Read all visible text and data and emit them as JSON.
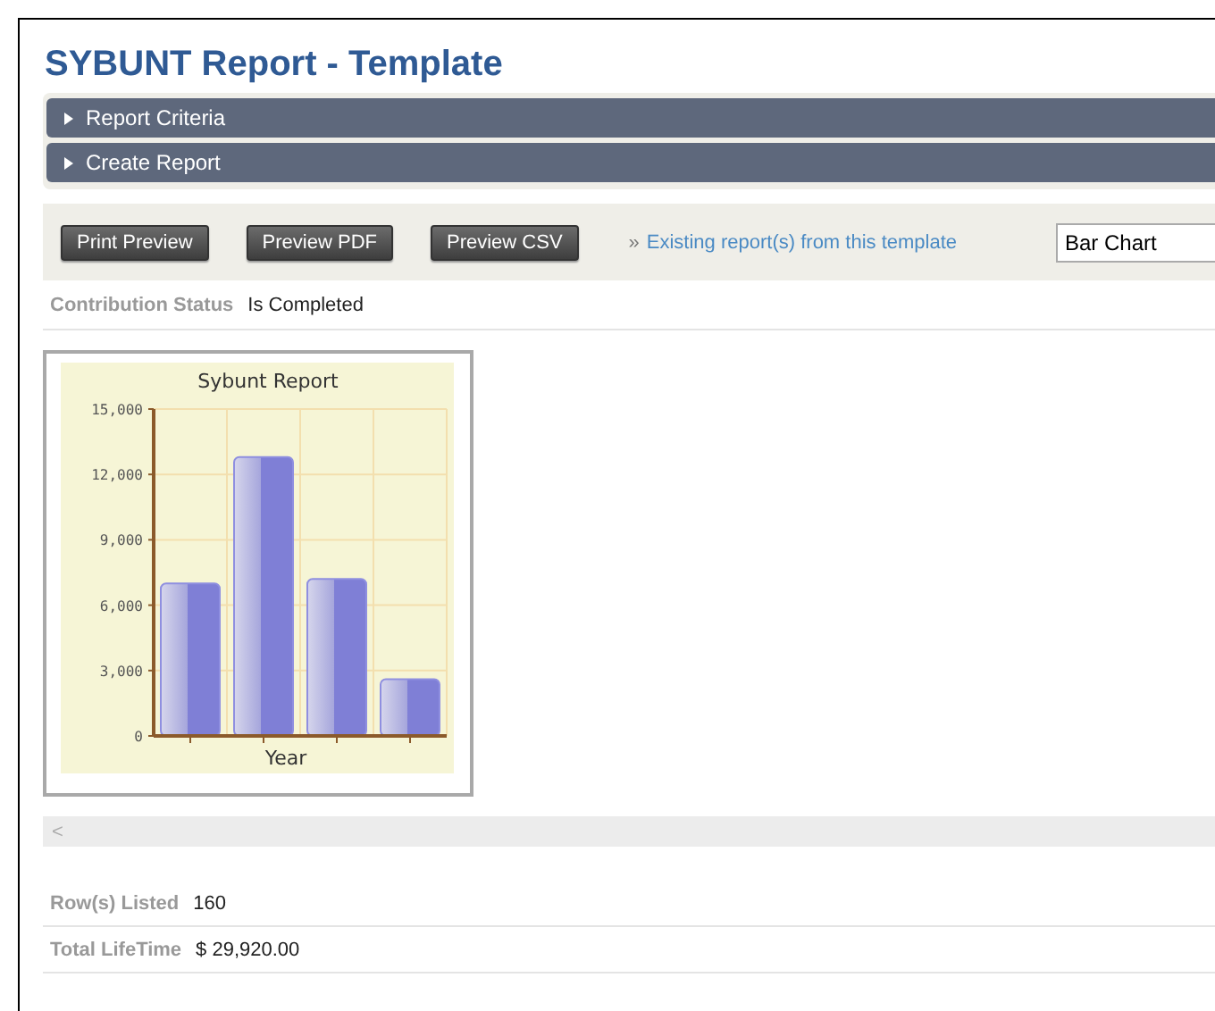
{
  "title": "SYBUNT Report - Template",
  "sections": [
    {
      "label": "Report Criteria",
      "expanded": false
    },
    {
      "label": "Create Report",
      "expanded": false
    }
  ],
  "toolbar": {
    "buttons": [
      "Print Preview",
      "Preview PDF",
      "Preview CSV"
    ],
    "link_marker": "»",
    "link": "Existing report(s) from this template",
    "chart_type": "Bar Chart"
  },
  "status": {
    "label": "Contribution Status",
    "value": "Is Completed"
  },
  "chart_data": {
    "type": "bar",
    "grid": true,
    "title": "Sybunt Report",
    "xlabel": "Year",
    "values": [
      7000,
      12800,
      7200,
      2600
    ],
    "ylim": [
      0,
      15000
    ],
    "yticks": [
      {
        "value": 0,
        "label": "0"
      },
      {
        "value": 3000,
        "label": "3,000"
      },
      {
        "value": 6000,
        "label": "6,000"
      },
      {
        "value": 9000,
        "label": "9,000"
      },
      {
        "value": 12000,
        "label": "12,000"
      },
      {
        "value": 15000,
        "label": "15,000"
      }
    ]
  },
  "scrollbar": {
    "arrow": "<"
  },
  "summary": [
    {
      "label": "Row(s) Listed",
      "value": "160"
    },
    {
      "label": "Total LifeTime",
      "value": "$ 29,920.00"
    }
  ]
}
